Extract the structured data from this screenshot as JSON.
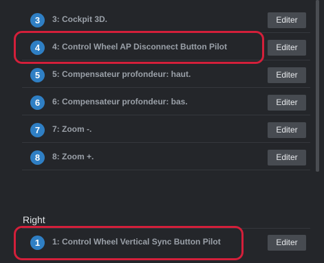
{
  "left_section": {
    "items": [
      {
        "num": "3",
        "label": "3: Cockpit 3D.",
        "button": "Editer"
      },
      {
        "num": "4",
        "label": "4: Control Wheel AP Disconnect Button Pilot",
        "button": "Editer"
      },
      {
        "num": "5",
        "label": "5: Compensateur profondeur: haut.",
        "button": "Editer"
      },
      {
        "num": "6",
        "label": "6: Compensateur profondeur: bas.",
        "button": "Editer"
      },
      {
        "num": "7",
        "label": "7: Zoom -.",
        "button": "Editer"
      },
      {
        "num": "8",
        "label": "8: Zoom +.",
        "button": "Editer"
      }
    ]
  },
  "right_section": {
    "title": "Right",
    "items": [
      {
        "num": "1",
        "label": "1: Control Wheel Vertical Sync Button Pilot",
        "button": "Editer"
      }
    ]
  },
  "colors": {
    "background": "#24262a",
    "badge": "#2f7fc4",
    "button": "#474b51",
    "highlight": "#d41f3a"
  }
}
